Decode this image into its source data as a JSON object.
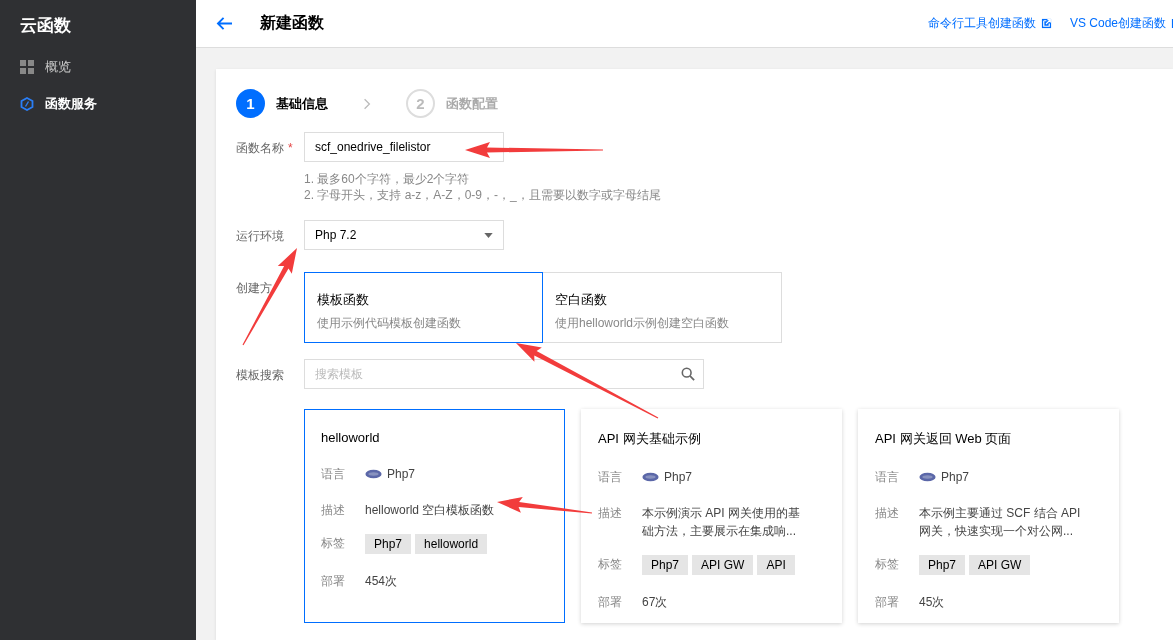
{
  "sidebar": {
    "title": "云函数",
    "items": [
      {
        "label": "概览",
        "selected": false
      },
      {
        "label": "函数服务",
        "selected": true
      }
    ]
  },
  "header": {
    "title": "新建函数",
    "links": [
      "命令行工具创建函数",
      "VS Code创建函数"
    ]
  },
  "steps": [
    {
      "number": "1",
      "label": "基础信息",
      "selected": true
    },
    {
      "number": "2",
      "label": "函数配置",
      "selected": false
    }
  ],
  "form": {
    "name": {
      "label": "函数名称",
      "required_mark": "*",
      "value": "scf_onedrive_filelistor",
      "hints": [
        "1. 最多60个字符，最少2个字符",
        "2. 字母开头，支持 a-z，A-Z，0-9，-，_，且需要以数字或字母结尾"
      ]
    },
    "runtime": {
      "label": "运行环境",
      "value": "Php 7.2"
    },
    "method": {
      "label": "创建方",
      "options": [
        {
          "title": "模板函数",
          "desc": "使用示例代码模板创建函数",
          "selected": true
        },
        {
          "title": "空白函数",
          "desc": "使用helloworld示例创建空白函数",
          "selected": false
        }
      ]
    },
    "search": {
      "label": "模板搜索",
      "placeholder": "搜索模板"
    }
  },
  "templates": [
    {
      "title": "helloworld",
      "selected": true,
      "fields": {
        "lang_label": "语言",
        "lang": "Php7",
        "desc_label": "描述",
        "desc": "helloworld 空白模板函数",
        "tags_label": "标签",
        "tags": [
          "Php7",
          "helloworld"
        ],
        "deploy_label": "部署",
        "deploys": "454次"
      }
    },
    {
      "title": "API 网关基础示例",
      "selected": false,
      "fields": {
        "lang_label": "语言",
        "lang": "Php7",
        "desc_label": "描述",
        "desc": "本示例演示 API 网关使用的基础方法，主要展示在集成响...",
        "tags_label": "标签",
        "tags": [
          "Php7",
          "API GW",
          "API"
        ],
        "deploy_label": "部署",
        "deploys": "67次"
      }
    },
    {
      "title": "API 网关返回 Web 页面",
      "selected": false,
      "fields": {
        "lang_label": "语言",
        "lang": "Php7",
        "desc_label": "描述",
        "desc": "本示例主要通过 SCF 结合 API 网关，快速实现一个对公网...",
        "tags_label": "标签",
        "tags": [
          "Php7",
          "API GW"
        ],
        "deploys": "45次",
        "deploy_label": "部署"
      }
    }
  ]
}
